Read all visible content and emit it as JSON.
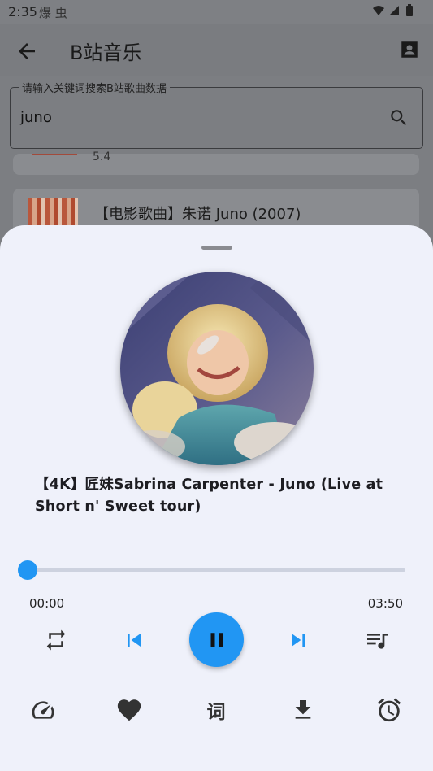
{
  "status_bar": {
    "time": "2:35",
    "left_icons": "爆 虫"
  },
  "app_bar": {
    "title": "B站音乐",
    "back_icon": "arrow-back-icon",
    "account_icon": "contact-card-icon"
  },
  "search": {
    "label": "请输入关键词搜索B站歌曲数据",
    "value": "juno",
    "icon": "search-icon"
  },
  "results": [
    {
      "count": "5.4"
    },
    {
      "title": "【电影歌曲】朱诺 Juno (2007)"
    }
  ],
  "player": {
    "song_title": "【4K】匠妹Sabrina Carpenter - Juno (Live at Short n' Sweet tour)",
    "current_time": "00:00",
    "total_time": "03:50",
    "progress": 0.0,
    "lyrics_label": "词",
    "accent_color": "#2196f3",
    "controls": [
      "repeat-icon",
      "skip-previous-icon",
      "pause-icon",
      "skip-next-icon",
      "playlist-icon"
    ],
    "actions": [
      "speed-icon",
      "favorite-icon",
      "lyrics-icon",
      "download-icon",
      "alarm-icon"
    ]
  }
}
